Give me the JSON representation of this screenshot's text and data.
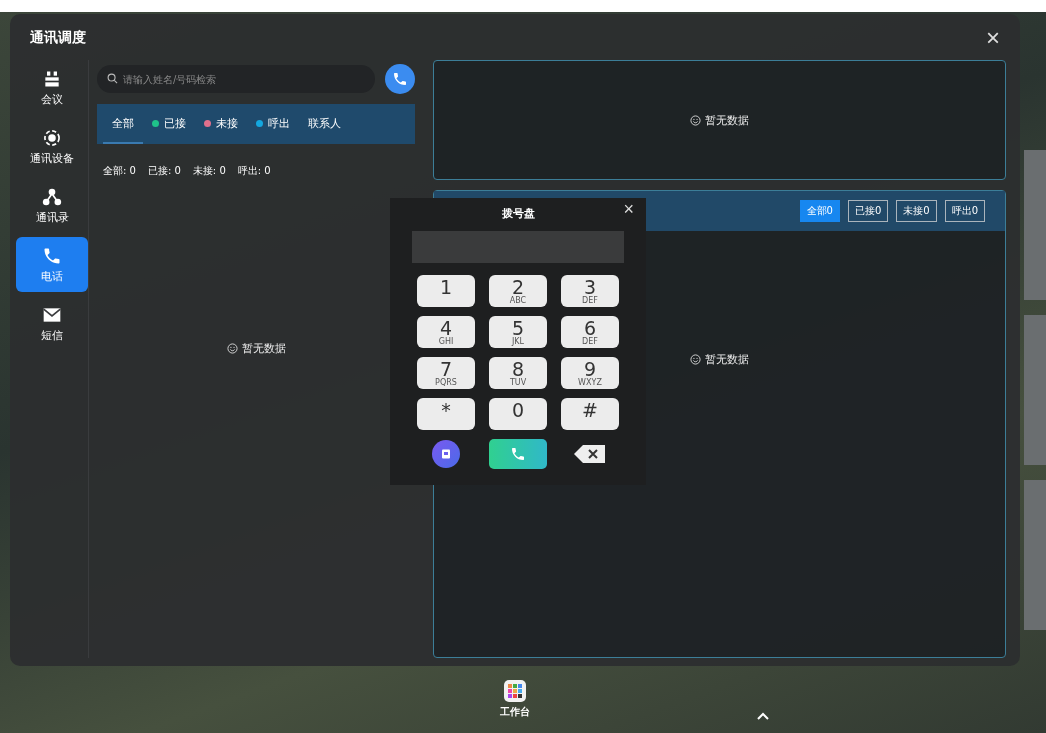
{
  "window": {
    "title": "通讯调度",
    "close": "×"
  },
  "sidebar": {
    "items": [
      {
        "label": "会议",
        "selected": false
      },
      {
        "label": "通讯设备",
        "selected": false
      },
      {
        "label": "通讯录",
        "selected": false
      },
      {
        "label": "电话",
        "selected": true
      },
      {
        "label": "短信",
        "selected": false
      }
    ]
  },
  "call_log": {
    "search": {
      "placeholder": "请输入姓名/号码检索"
    },
    "filters": [
      {
        "label": "全部",
        "selected": true
      },
      {
        "label": "已接",
        "selected": false,
        "color": "#1fc28a"
      },
      {
        "label": "未接",
        "selected": false,
        "color": "#e0708c"
      },
      {
        "label": "呼出",
        "selected": false,
        "color": "#14a8e0"
      },
      {
        "label": "联系人",
        "selected": false
      }
    ],
    "stats": [
      "全部: 0",
      "已接: 0",
      "未接: 0",
      "呼出: 0"
    ],
    "empty_text": "暂无数据"
  },
  "top_panel": {
    "empty_text": "暂无数据"
  },
  "records_panel": {
    "filters": [
      {
        "label": "全部0",
        "selected": true
      },
      {
        "label": "已接0",
        "selected": false
      },
      {
        "label": "未接0",
        "selected": false
      },
      {
        "label": "呼出0",
        "selected": false
      }
    ],
    "empty_text": "暂无数据"
  },
  "dialpad": {
    "title": "拨号盘",
    "close": "×",
    "keys": [
      {
        "digit": "1"
      },
      {
        "digit": "2",
        "letters": "ABC"
      },
      {
        "digit": "3",
        "letters": "DEF"
      },
      {
        "digit": "4",
        "letters": "GHI"
      },
      {
        "digit": "5",
        "letters": "JKL"
      },
      {
        "digit": "6",
        "letters": "DEF"
      },
      {
        "digit": "7",
        "letters": "PQRS"
      },
      {
        "digit": "8",
        "letters": "TUV"
      },
      {
        "digit": "9",
        "letters": "WXYZ"
      },
      {
        "digit": "*"
      },
      {
        "digit": "0"
      },
      {
        "digit": "#"
      }
    ]
  },
  "taskbar": {
    "items": [
      {
        "label": "工作台"
      }
    ]
  }
}
